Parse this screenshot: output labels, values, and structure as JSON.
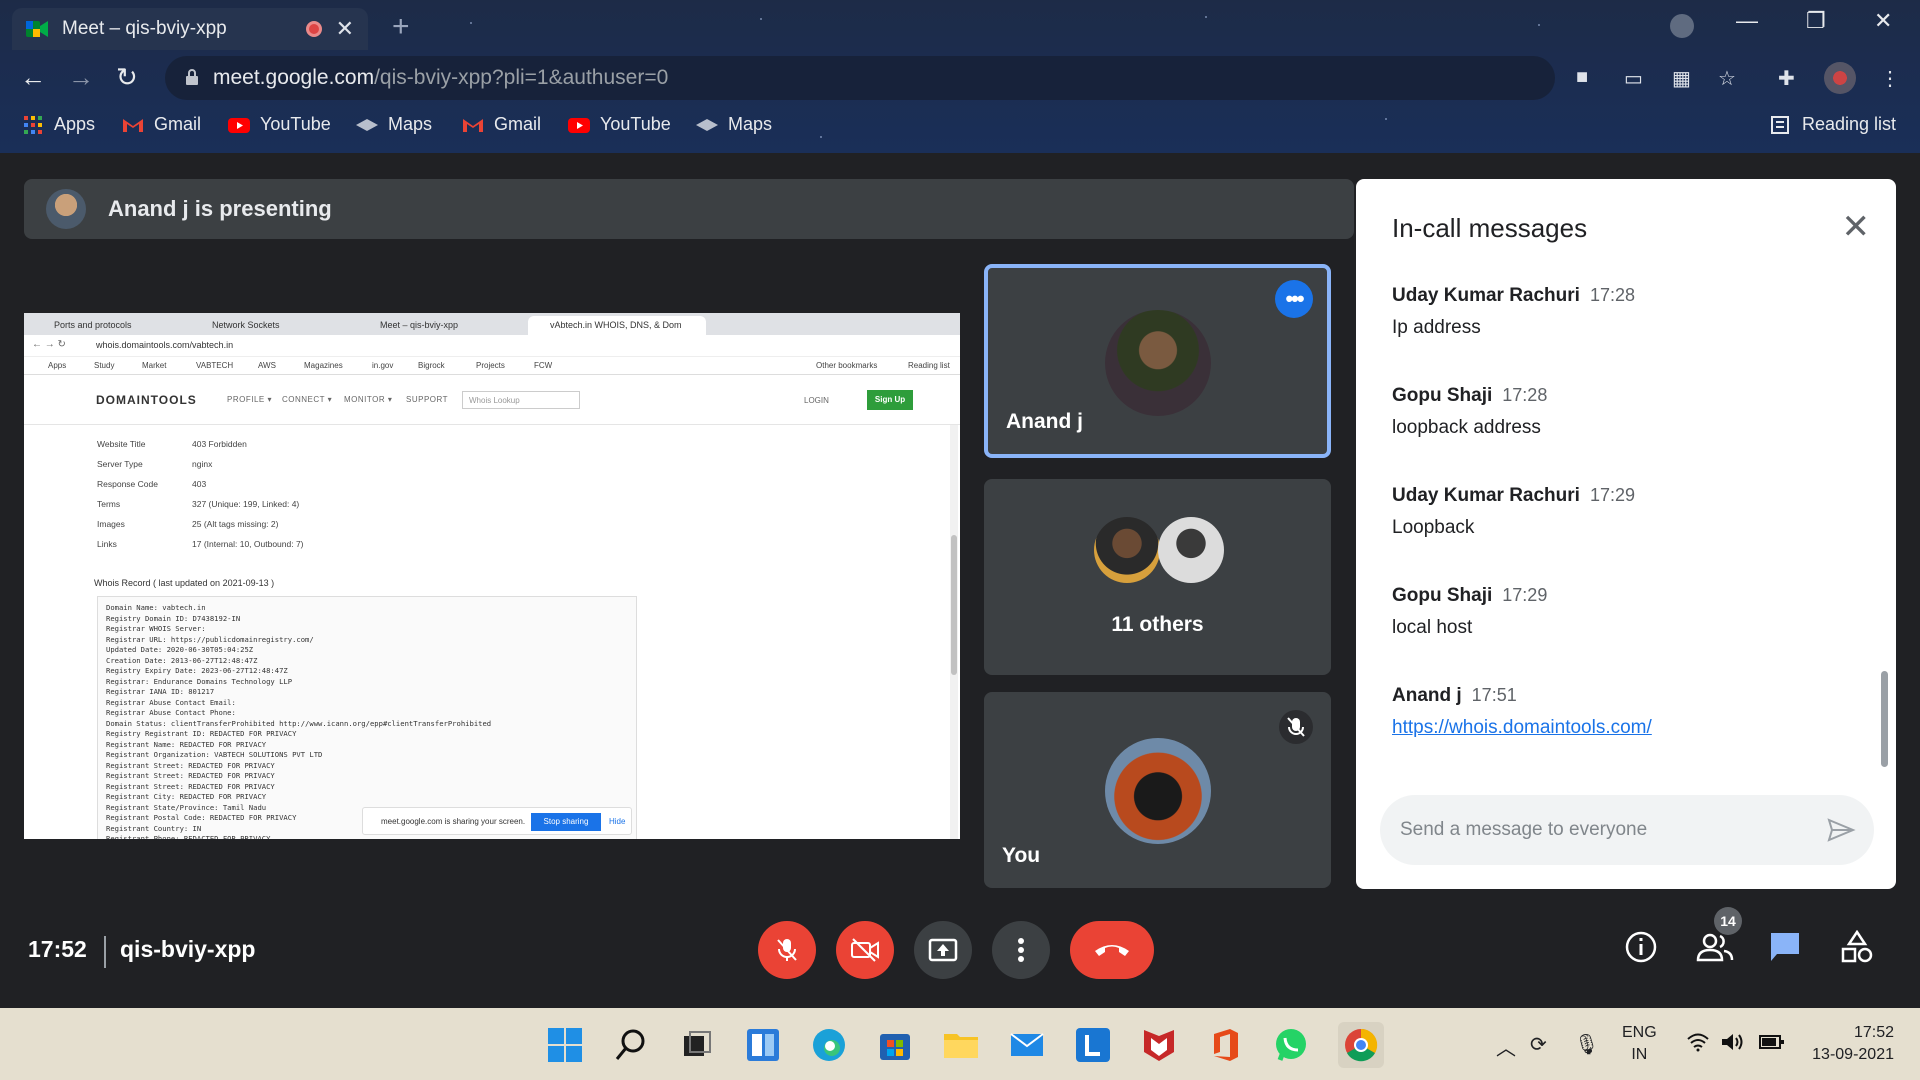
{
  "browser": {
    "tab_title": "Meet – qis-bviy-xpp",
    "new_tab": "+",
    "url_domain": "meet.google.com",
    "url_path": "/qis-bviy-xpp?pli=1&authuser=0",
    "bookmarks": [
      {
        "label": "Apps",
        "icon": "apps-grid-icon"
      },
      {
        "label": "Gmail",
        "icon": "gmail-icon"
      },
      {
        "label": "YouTube",
        "icon": "youtube-icon"
      },
      {
        "label": "Maps",
        "icon": "maps-icon"
      },
      {
        "label": "Gmail",
        "icon": "gmail-icon"
      },
      {
        "label": "YouTube",
        "icon": "youtube-icon"
      },
      {
        "label": "Maps",
        "icon": "maps-icon"
      }
    ],
    "reading_list": "Reading list"
  },
  "presenting": {
    "text": "Anand j is presenting"
  },
  "shared_screen": {
    "tabs": [
      "Ports and protocols",
      "Network Sockets",
      "Meet – qis-bviy-xpp",
      "vAbtech.in WHOIS, DNS, & Dom"
    ],
    "url": "whois.domaintools.com/vabtech.in",
    "bookmarks": [
      "Apps",
      "Study",
      "Market",
      "VABTECH",
      "AWS",
      "Magazines",
      "in.gov",
      "Bigrock",
      "Projects",
      "FCW",
      "Other bookmarks",
      "Reading list"
    ],
    "logo": "DOMAINTOOLS",
    "menu": [
      "PROFILE ▾",
      "CONNECT ▾",
      "MONITOR ▾",
      "SUPPORT"
    ],
    "lookup_placeholder": "Whois Lookup",
    "login": "LOGIN",
    "signup": "Sign Up",
    "rows": [
      {
        "k": "Website Title",
        "v": "403 Forbidden"
      },
      {
        "k": "Server Type",
        "v": "nginx"
      },
      {
        "k": "Response Code",
        "v": "403"
      },
      {
        "k": "Terms",
        "v": "327 (Unique: 199, Linked: 4)"
      },
      {
        "k": "Images",
        "v": "25 (Alt tags missing: 2)"
      },
      {
        "k": "Links",
        "v": "17  (Internal: 10, Outbound: 7)"
      }
    ],
    "whois_heading": "Whois Record ( last updated on 2021-09-13 )",
    "record_text": "Domain Name: vabtech.in\nRegistry Domain ID: D7438192-IN\nRegistrar WHOIS Server:\nRegistrar URL: https://publicdomainregistry.com/\nUpdated Date: 2020-06-30T05:04:25Z\nCreation Date: 2013-06-27T12:48:47Z\nRegistry Expiry Date: 2023-06-27T12:48:47Z\nRegistrar: Endurance Domains Technology LLP\nRegistrar IANA ID: 801217\nRegistrar Abuse Contact Email:\nRegistrar Abuse Contact Phone:\nDomain Status: clientTransferProhibited http://www.icann.org/epp#clientTransferProhibited\nRegistry Registrant ID: REDACTED FOR PRIVACY\nRegistrant Name: REDACTED FOR PRIVACY\nRegistrant Organization: VABTECH SOLUTIONS PVT LTD\nRegistrant Street: REDACTED FOR PRIVACY\nRegistrant Street: REDACTED FOR PRIVACY\nRegistrant Street: REDACTED FOR PRIVACY\nRegistrant City: REDACTED FOR PRIVACY\nRegistrant State/Province: Tamil Nadu\nRegistrant Postal Code: REDACTED FOR PRIVACY\nRegistrant Country: IN\nRegistrant Phone: REDACTED FOR PRIVACY\nRegistrant Phone Ext: REDACTED FOR PRIVACY",
    "sharing_text": "meet.google.com is sharing your screen.",
    "stop_sharing": "Stop sharing",
    "hide": "Hide"
  },
  "participants": [
    {
      "name": "Anand j",
      "icon": "more-options-icon"
    },
    {
      "name": "11 others"
    },
    {
      "name": "You",
      "icon": "mic-off-icon"
    }
  ],
  "chat": {
    "title": "In-call messages",
    "messages": [
      {
        "sender": "Uday Kumar Rachuri",
        "time": "17:28",
        "text": "Ip address"
      },
      {
        "sender": "Gopu Shaji",
        "time": "17:28",
        "text": "loopback address"
      },
      {
        "sender": "Uday Kumar Rachuri",
        "time": "17:29",
        "text": "Loopback"
      },
      {
        "sender": "Gopu Shaji",
        "time": "17:29",
        "text": "local host"
      },
      {
        "sender": "Anand j",
        "time": "17:51",
        "text": "https://whois.domaintools.com/"
      }
    ],
    "input_placeholder": "Send a message to everyone"
  },
  "bottom_bar": {
    "time": "17:52",
    "meeting_code": "qis-bviy-xpp",
    "people_count": "14"
  },
  "taskbar": {
    "lang_line1": "ENG",
    "lang_line2": "IN",
    "clock_time": "17:52",
    "clock_date": "13-09-2021"
  },
  "colors": {
    "accent": "#1a73e8",
    "danger": "#ea4335",
    "surface": "#3c4043",
    "background": "#202124"
  }
}
